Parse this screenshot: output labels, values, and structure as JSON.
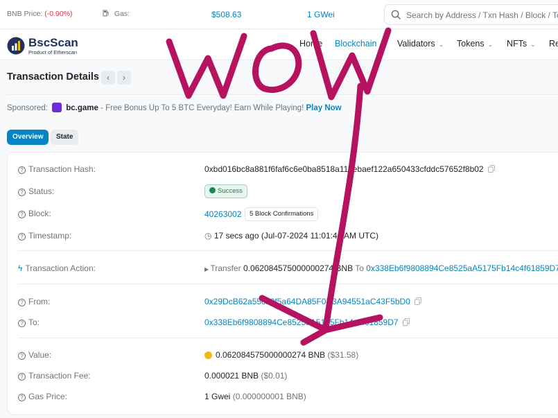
{
  "topbar": {
    "price_label": "BNB Price:",
    "price_value": "$508.63",
    "price_change": "(-0.90%)",
    "gas_label": "Gas:",
    "gas_value": "1 GWei",
    "search_placeholder": "Search by Address / Txn Hash / Block / To"
  },
  "brand": {
    "name": "BscScan",
    "sub": "Product of Etherscan"
  },
  "nav": {
    "home": "Home",
    "blockchain": "Blockchain",
    "validators": "Validators",
    "tokens": "Tokens",
    "nfts": "NFTs",
    "resources": "Re"
  },
  "page": {
    "title": "Transaction Details",
    "prev_icon": "chevron-left-icon",
    "next_icon": "chevron-right-icon"
  },
  "sponsor": {
    "label": "Sponsored:",
    "brand": "bc.game",
    "text": "- Free Bonus Up To 5 BTC Everyday! Earn While Playing!",
    "cta": "Play Now"
  },
  "tabs": {
    "overview": "Overview",
    "state": "State"
  },
  "details": {
    "hash_label": "Transaction Hash:",
    "hash_value": "0xbd016bc8a881f6faf6c6e0ba8518a11ffebaef122a650433cfddc57652f8b02",
    "status_label": "Status:",
    "status_value": "Success",
    "block_label": "Block:",
    "block_value": "40263002",
    "block_confirmations": "5 Block Confirmations",
    "timestamp_label": "Timestamp:",
    "timestamp_value": "17 secs ago (Jul-07-2024 11:01:40 AM UTC)",
    "action_label": "Transaction Action:",
    "action_prefix": "Transfer",
    "action_amount": "0.062084575000000274 BNB",
    "action_to_label": "To",
    "action_to": "0x338Eb6f9808894Ce8525aA5175Fb14c4f61859D7",
    "from_label": "From:",
    "from_value": "0x29DcB62a55c99f5a64DA85F0D3A94551aC43F5bD0",
    "to_label": "To:",
    "to_value": "0x338Eb6f9808894Ce8525aA5175Fb14c4f61859D7",
    "value_label": "Value:",
    "value_amount": "0.062084575000000274 BNB",
    "value_usd": "($31.58)",
    "fee_label": "Transaction Fee:",
    "fee_amount": "0.000021 BNB",
    "fee_usd": "($0.01)",
    "gas_label": "Gas Price:",
    "gas_amount": "1 Gwei",
    "gas_bnb": "(0.000000001 BNB)"
  },
  "annotation": {
    "text": "WOW",
    "color": "#b5125f"
  },
  "colors": {
    "accent": "#0784c3",
    "success": "#198754",
    "ink": "#b5125f"
  }
}
